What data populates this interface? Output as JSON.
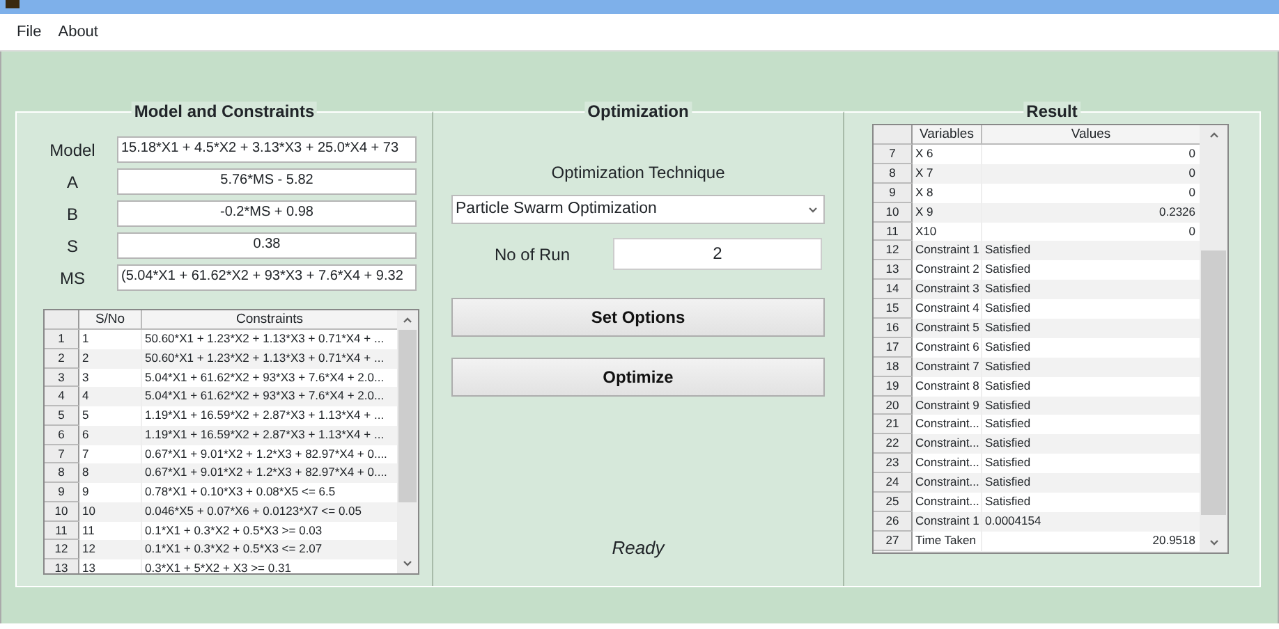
{
  "menu": [
    {
      "label": "File"
    },
    {
      "label": "About"
    }
  ],
  "model_panel": {
    "title": "Model and Constraints",
    "fields": [
      {
        "label": "Model",
        "value": "15.18*X1 + 4.5*X2 + 3.13*X3 + 25.0*X4 + 73",
        "kind": "overflow"
      },
      {
        "label": "A",
        "value": "5.76*MS - 5.82",
        "kind": "short"
      },
      {
        "label": "B",
        "value": "-0.2*MS + 0.98",
        "kind": "short"
      },
      {
        "label": "S",
        "value": "0.38",
        "kind": "short"
      },
      {
        "label": "MS",
        "value": "(5.04*X1 + 61.62*X2 + 93*X3 + 7.6*X4 + 9.32",
        "kind": "overflow"
      }
    ],
    "table": {
      "columns": [
        "S/No",
        "Constraints"
      ],
      "rows": [
        {
          "index": "1",
          "sno": "1",
          "constraint": "50.60*X1 + 1.23*X2 + 1.13*X3 + 0.71*X4 + ..."
        },
        {
          "index": "2",
          "sno": "2",
          "constraint": "50.60*X1 + 1.23*X2 + 1.13*X3 + 0.71*X4 + ..."
        },
        {
          "index": "3",
          "sno": "3",
          "constraint": "5.04*X1 + 61.62*X2 + 93*X3 + 7.6*X4 + 2.0..."
        },
        {
          "index": "4",
          "sno": "4",
          "constraint": "5.04*X1 + 61.62*X2 + 93*X3 + 7.6*X4 + 2.0..."
        },
        {
          "index": "5",
          "sno": "5",
          "constraint": "1.19*X1 + 16.59*X2 + 2.87*X3 + 1.13*X4 + ..."
        },
        {
          "index": "6",
          "sno": "6",
          "constraint": "1.19*X1 + 16.59*X2 + 2.87*X3 + 1.13*X4 + ..."
        },
        {
          "index": "7",
          "sno": "7",
          "constraint": "0.67*X1 + 9.01*X2 + 1.2*X3 + 82.97*X4 + 0...."
        },
        {
          "index": "8",
          "sno": "8",
          "constraint": "0.67*X1 + 9.01*X2 + 1.2*X3 + 82.97*X4 + 0...."
        },
        {
          "index": "9",
          "sno": "9",
          "constraint": "0.78*X1 + 0.10*X3 + 0.08*X5  <= 6.5"
        },
        {
          "index": "10",
          "sno": "10",
          "constraint": "0.046*X5 + 0.07*X6 + 0.0123*X7 <= 0.05"
        },
        {
          "index": "11",
          "sno": "11",
          "constraint": "0.1*X1 + 0.3*X2 + 0.5*X3 >= 0.03"
        },
        {
          "index": "12",
          "sno": "12",
          "constraint": "0.1*X1 + 0.3*X2 + 0.5*X3 <= 2.07"
        },
        {
          "index": "13",
          "sno": "13",
          "constraint": "0.3*X1 + 5*X2 + X3 >= 0.31"
        }
      ]
    }
  },
  "optimization_panel": {
    "title": "Optimization",
    "technique_label": "Optimization Technique",
    "technique": "Particle Swarm Optimization",
    "runs_label": "No of Run",
    "runs": "2",
    "buttons": [
      "Set Options",
      "Optimize"
    ],
    "status": "Ready"
  },
  "result_panel": {
    "title": "Result",
    "table": {
      "columns": [
        "Variables",
        "Values"
      ],
      "rows": [
        {
          "index": "7",
          "variable": "X 6",
          "value": "0",
          "kind": "number"
        },
        {
          "index": "8",
          "variable": "X 7",
          "value": "0",
          "kind": "number"
        },
        {
          "index": "9",
          "variable": "X 8",
          "value": "0",
          "kind": "number"
        },
        {
          "index": "10",
          "variable": "X 9",
          "value": "0.2326",
          "kind": "number"
        },
        {
          "index": "11",
          "variable": "X10",
          "value": "0",
          "kind": "number"
        },
        {
          "index": "12",
          "variable": "Constraint 1",
          "value": "Satisfied",
          "kind": "text"
        },
        {
          "index": "13",
          "variable": "Constraint 2",
          "value": "Satisfied",
          "kind": "text"
        },
        {
          "index": "14",
          "variable": "Constraint 3",
          "value": "Satisfied",
          "kind": "text"
        },
        {
          "index": "15",
          "variable": "Constraint 4",
          "value": "Satisfied",
          "kind": "text"
        },
        {
          "index": "16",
          "variable": "Constraint 5",
          "value": "Satisfied",
          "kind": "text"
        },
        {
          "index": "17",
          "variable": "Constraint 6",
          "value": "Satisfied",
          "kind": "text"
        },
        {
          "index": "18",
          "variable": "Constraint 7",
          "value": "Satisfied",
          "kind": "text"
        },
        {
          "index": "19",
          "variable": "Constraint 8",
          "value": "Satisfied",
          "kind": "text"
        },
        {
          "index": "20",
          "variable": "Constraint 9",
          "value": "Satisfied",
          "kind": "text"
        },
        {
          "index": "21",
          "variable": "Constraint...",
          "value": "Satisfied",
          "kind": "text"
        },
        {
          "index": "22",
          "variable": "Constraint...",
          "value": "Satisfied",
          "kind": "text"
        },
        {
          "index": "23",
          "variable": "Constraint...",
          "value": "Satisfied",
          "kind": "text"
        },
        {
          "index": "24",
          "variable": "Constraint...",
          "value": "Satisfied",
          "kind": "text"
        },
        {
          "index": "25",
          "variable": "Constraint...",
          "value": "Satisfied",
          "kind": "text"
        },
        {
          "index": "26",
          "variable": "Constraint 1",
          "value": "0.0004154",
          "kind": "text"
        },
        {
          "index": "27",
          "variable": "Time Taken",
          "value": "20.9518",
          "kind": "number"
        }
      ]
    }
  }
}
